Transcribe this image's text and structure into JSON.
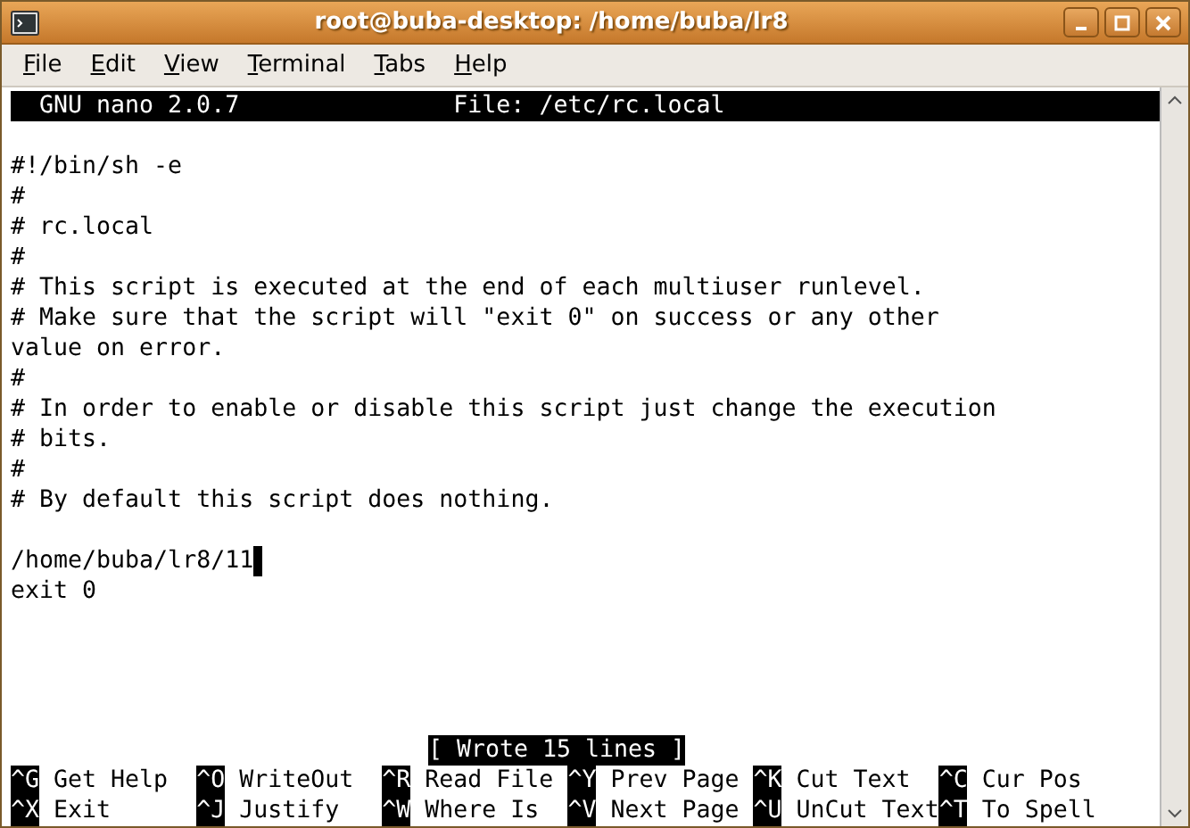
{
  "window": {
    "title": "root@buba-desktop: /home/buba/lr8"
  },
  "menu": [
    "File",
    "Edit",
    "View",
    "Terminal",
    "Tabs",
    "Help"
  ],
  "nano_header": {
    "program": "GNU nano 2.0.7",
    "file": "File: /etc/rc.local"
  },
  "text_blocks": [
    [
      {
        "text": "#!/bin/sh -e",
        "cursor": false
      },
      {
        "text": "#",
        "cursor": false
      },
      {
        "text": "# rc.local",
        "cursor": false
      },
      {
        "text": "#",
        "cursor": false
      },
      {
        "text": "# This script is executed at the end of each multiuser runlevel.",
        "cursor": false
      },
      {
        "text": "# Make sure that the script will \"exit 0\" on success or any other",
        "cursor": false
      },
      {
        "text": "value on error.",
        "cursor": false
      },
      {
        "text": "#",
        "cursor": false
      },
      {
        "text": "# In order to enable or disable this script just change the execution",
        "cursor": false
      },
      {
        "text": "# bits.",
        "cursor": false
      },
      {
        "text": "#",
        "cursor": false
      },
      {
        "text": "# By default this script does nothing.",
        "cursor": false
      }
    ],
    [
      {
        "text": "/home/buba/lr8/11",
        "cursor": true
      },
      {
        "text": "exit 0",
        "cursor": false
      }
    ]
  ],
  "status_message": "[ Wrote 15 lines ]",
  "shortcut_rows": [
    [
      {
        "key": "^G",
        "label": "Get Help"
      },
      {
        "key": "^O",
        "label": "WriteOut"
      },
      {
        "key": "^R",
        "label": "Read File"
      },
      {
        "key": "^Y",
        "label": "Prev Page"
      },
      {
        "key": "^K",
        "label": "Cut Text"
      },
      {
        "key": "^C",
        "label": "Cur Pos"
      }
    ],
    [
      {
        "key": "^X",
        "label": "Exit"
      },
      {
        "key": "^J",
        "label": "Justify"
      },
      {
        "key": "^W",
        "label": "Where Is"
      },
      {
        "key": "^V",
        "label": "Next Page"
      },
      {
        "key": "^U",
        "label": "UnCut Text"
      },
      {
        "key": "^T",
        "label": "To Spell"
      }
    ]
  ]
}
